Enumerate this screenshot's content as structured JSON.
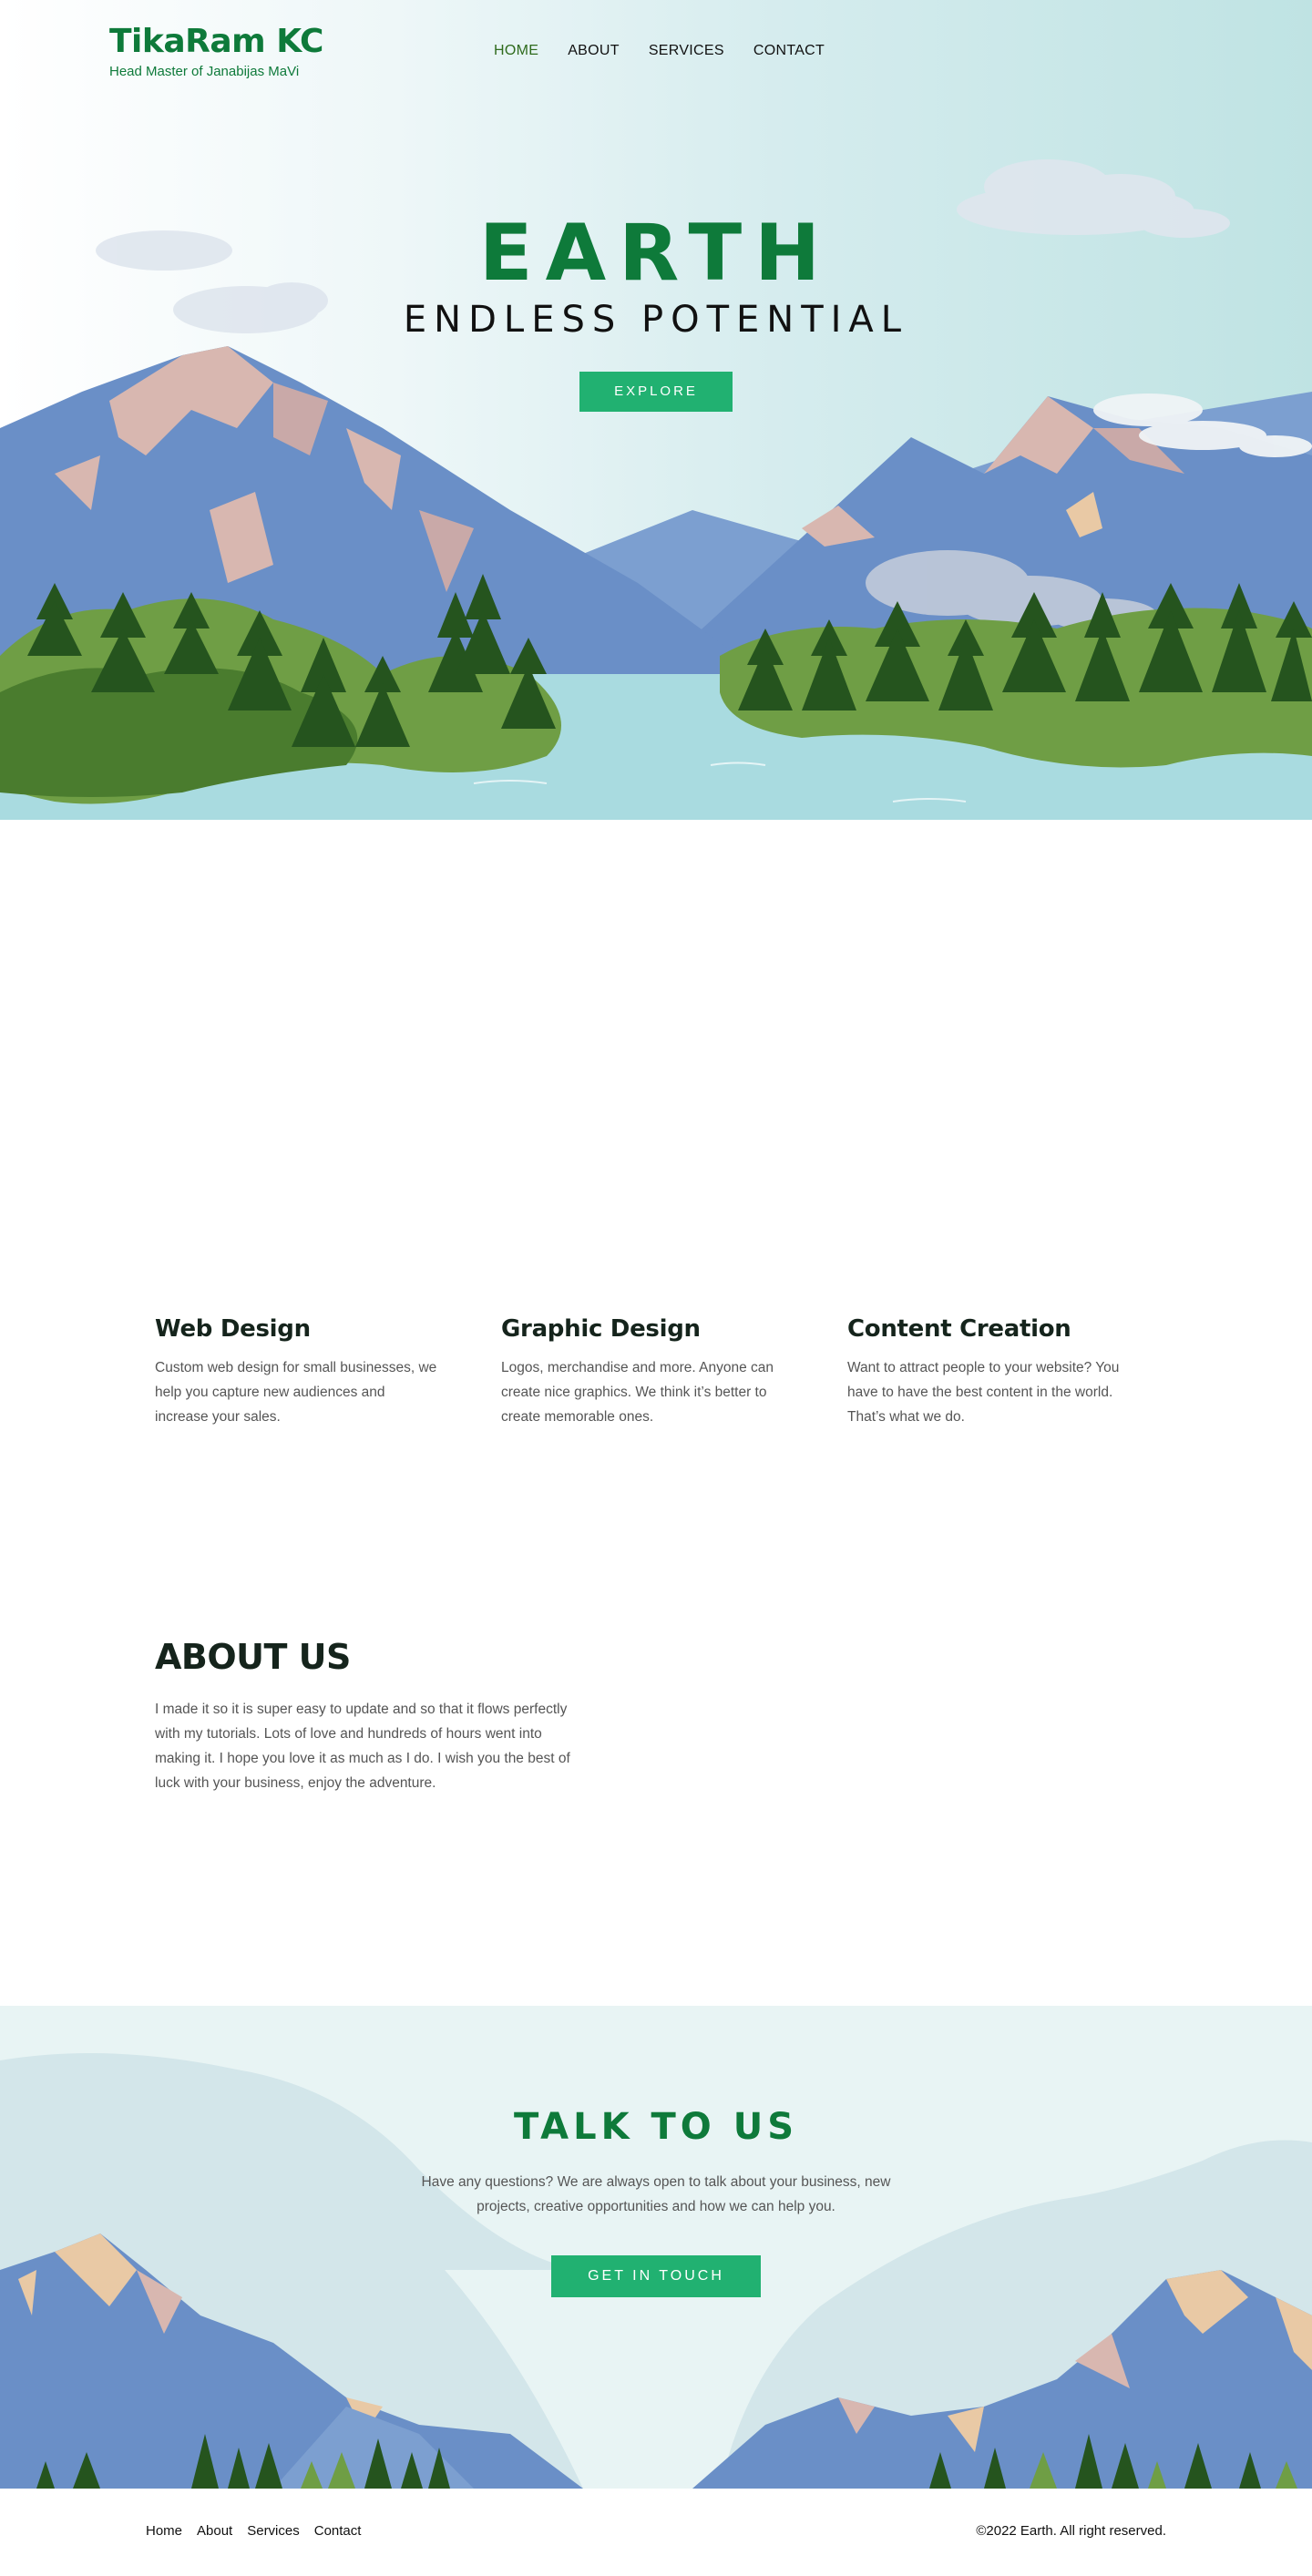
{
  "brand": {
    "name": "TikaRam KC",
    "tagline": "Head Master of Janabijas MaVi"
  },
  "nav": {
    "items": [
      {
        "label": "HOME",
        "active": true
      },
      {
        "label": "ABOUT",
        "active": false
      },
      {
        "label": "SERVICES",
        "active": false
      },
      {
        "label": "CONTACT",
        "active": false
      }
    ]
  },
  "hero": {
    "title": "EARTH",
    "subtitle": "ENDLESS POTENTIAL",
    "button_label": "EXPLORE"
  },
  "services": [
    {
      "title": "Web Design",
      "text": "Custom web design for small businesses, we help you capture new audiences and increase your sales."
    },
    {
      "title": "Graphic Design",
      "text": "Logos, merchandise and more. Anyone can create nice graphics. We think it’s better to create memorable ones."
    },
    {
      "title": "Content Creation",
      "text": "Want to attract people to your website?  You have to have the best content in the world. That’s what we do."
    }
  ],
  "about": {
    "title": "ABOUT US",
    "text": "I made it so it is super easy to update and so that it flows perfectly with my tutorials. Lots of love and hundreds of hours went into making it. I hope you love it as much as I do. I wish you the best of luck with your business, enjoy the adventure."
  },
  "talk": {
    "title": "TALK TO US",
    "text": "Have any questions? We are always open to talk about your business, new projects, creative opportunities and how we can help you.",
    "button_label": "GET IN TOUCH"
  },
  "footer": {
    "links": [
      "Home",
      "About",
      "Services",
      "Contact"
    ],
    "copyright": "©2022 Earth. All right reserved."
  },
  "colors": {
    "brand_green": "#0e7a3a",
    "button_green": "#21b171",
    "mountain_blue": "#6a8fc7",
    "forest_dark": "#25541e",
    "water": "#a9dbe0"
  }
}
